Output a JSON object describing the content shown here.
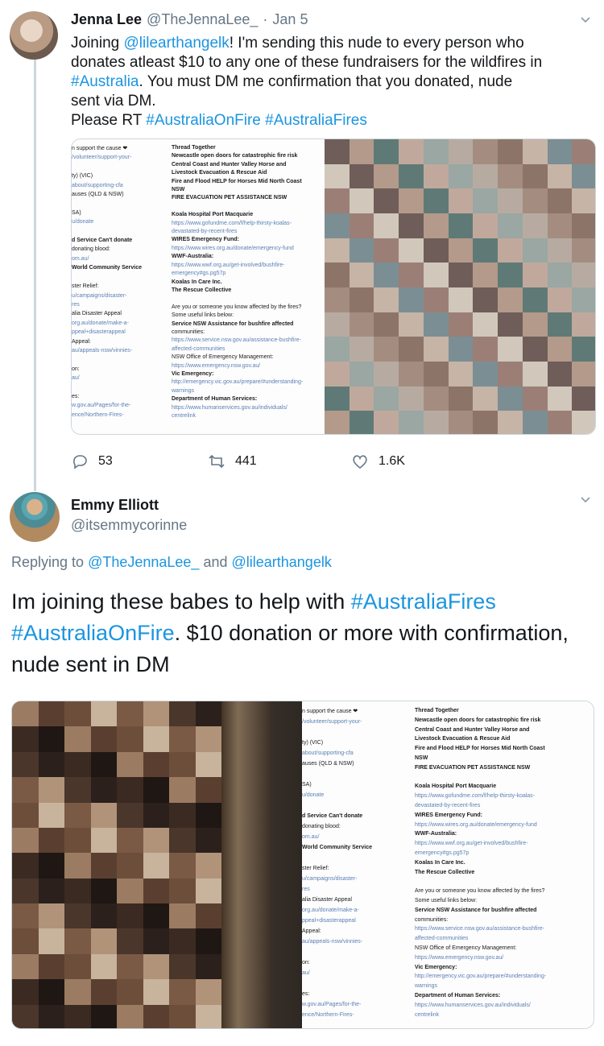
{
  "tweet1": {
    "name": "Jenna Lee",
    "handle": "@TheJennaLee_",
    "separator": "·",
    "date": "Jan 5",
    "text": {
      "l1a": "Joining ",
      "l1b": "@lilearthangelk",
      "l1c": "! I'm sending this nude to every person who",
      "l2": "donates atleast $10 to any one of these fundraisers for the wildfires in",
      "l3a": "#Australia",
      "l3b": ". You must DM me confirmation that you donated, nude",
      "l4": "sent via DM.",
      "l5a": "Please RT ",
      "l5b": "#AustraliaOnFire",
      "l5c": "#AustraliaFires"
    },
    "actions": {
      "replies": "53",
      "retweets": "441",
      "likes": "1.6K"
    }
  },
  "tweet2": {
    "name": "Emmy Elliott",
    "handle": "@itsemmycorinne",
    "reply_prefix": "Replying to ",
    "reply_to_1": "@TheJennaLee_",
    "reply_and": " and ",
    "reply_to_2": "@lilearthangelk",
    "text": {
      "a": "Im joining these babes to help with ",
      "b": "#AustraliaFires",
      "c": "#AustraliaOnFire",
      "d": ". $10 donation or more with confirmation, nude sent in DM"
    }
  },
  "sheet_left": [
    {
      "t": "n support the cause ❤",
      "s": ""
    },
    {
      "t": "/volunteer/support-your-",
      "s": "l"
    },
    {
      "t": "",
      "s": ""
    },
    {
      "t": "ty) (VIC)",
      "s": ""
    },
    {
      "t": "about/supporting-cfa",
      "s": "l"
    },
    {
      "t": "auses (QLD & NSW)",
      "s": ""
    },
    {
      "t": "",
      "s": ""
    },
    {
      "t": "SA)",
      "s": ""
    },
    {
      "t": "u/donate",
      "s": "l"
    },
    {
      "t": "",
      "s": ""
    },
    {
      "t": "d Service Can't donate",
      "s": "b"
    },
    {
      "t": "donating blood:",
      "s": ""
    },
    {
      "t": "om.au/",
      "s": "l"
    },
    {
      "t": "World Community Service",
      "s": "b"
    },
    {
      "t": "",
      "s": ""
    },
    {
      "t": "ster Relief:",
      "s": ""
    },
    {
      "t": "u/campaigns/disaster-",
      "s": "l"
    },
    {
      "t": "res",
      "s": "l"
    },
    {
      "t": "alia Disaster Appeal",
      "s": ""
    },
    {
      "t": "org.au/donate/make-a-",
      "s": "l"
    },
    {
      "t": "ppeal+disasterappeal",
      "s": "l"
    },
    {
      "t": "Appeal:",
      "s": ""
    },
    {
      "t": "au/appeals-nsw/vinnies-",
      "s": "l"
    },
    {
      "t": "",
      "s": ""
    },
    {
      "t": "on:",
      "s": ""
    },
    {
      "t": "au/",
      "s": "l"
    },
    {
      "t": "",
      "s": ""
    },
    {
      "t": "es:",
      "s": ""
    },
    {
      "t": "w.gov.au/Pages/for-the-",
      "s": "l"
    },
    {
      "t": "ence/Northern-Fires-",
      "s": "l"
    }
  ],
  "sheet_right": [
    {
      "t": "Thread Together",
      "s": "b"
    },
    {
      "t": "Newcastle open doors for catastrophic fire risk",
      "s": "b"
    },
    {
      "t": "Central Coast and Hunter Valley Horse and",
      "s": "b"
    },
    {
      "t": "Livestock Evacuation & Rescue Aid",
      "s": "b"
    },
    {
      "t": "Fire and Flood HELP for Horses Mid North Coast",
      "s": "b"
    },
    {
      "t": "NSW",
      "s": "b"
    },
    {
      "t": "FIRE EVACUATION PET ASSISTANCE NSW",
      "s": "b"
    },
    {
      "t": "",
      "s": ""
    },
    {
      "t": "Koala Hospital Port Macquarie",
      "s": "b"
    },
    {
      "t": "https://www.gofundme.com/f/help-thirsty-koalas-",
      "s": "l"
    },
    {
      "t": "devastated-by-recent-fires",
      "s": "l"
    },
    {
      "t": "WIRES Emergency Fund:",
      "s": "b"
    },
    {
      "t": "https://www.wires.org.au/donate/emergency-fund",
      "s": "l"
    },
    {
      "t": "WWF-Australia:",
      "s": "b"
    },
    {
      "t": "https://www.wwf.org.au/get-involved/bushfire-",
      "s": "l"
    },
    {
      "t": "emergency#gs.pg57p",
      "s": "l"
    },
    {
      "t": "Koalas In Care Inc.",
      "s": "b"
    },
    {
      "t": "The Rescue Collective",
      "s": "b"
    },
    {
      "t": "",
      "s": ""
    },
    {
      "t": "Are you or someone you know affected by the fires?",
      "s": ""
    },
    {
      "t": "Some useful links below:",
      "s": ""
    },
    {
      "t": "Service NSW Assistance for bushfire affected",
      "s": "b"
    },
    {
      "t": "communities:",
      "s": ""
    },
    {
      "t": "https://www.service.nsw.gov.au/assistance-bushfire-",
      "s": "l"
    },
    {
      "t": "affected-communities",
      "s": "l"
    },
    {
      "t": "NSW Office of Emergency Management:",
      "s": ""
    },
    {
      "t": "https://www.emergency.nsw.gov.au/",
      "s": "l"
    },
    {
      "t": "Vic Emergency:",
      "s": "b"
    },
    {
      "t": "http://emergency.vic.gov.au/prepare/#understanding-",
      "s": "l"
    },
    {
      "t": "warnings",
      "s": "l"
    },
    {
      "t": "Department of Human Services:",
      "s": "b"
    },
    {
      "t": "https://www.humanservices.gov.au/individuals/",
      "s": "l"
    },
    {
      "t": "centrelink",
      "s": "l"
    }
  ],
  "colors": {
    "link": "#1b95e0",
    "muted": "#657786",
    "border": "#ccd6dd"
  },
  "icons": [
    "chevron-down-icon",
    "reply-icon",
    "retweet-icon",
    "like-icon"
  ]
}
